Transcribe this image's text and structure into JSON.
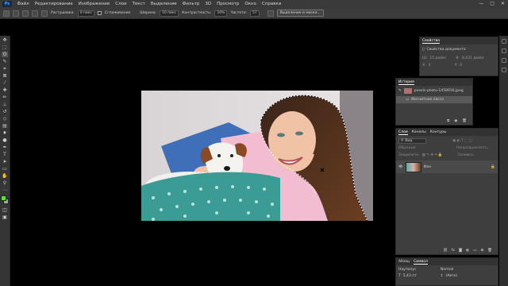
{
  "menubar": {
    "logo": "Ps",
    "items": [
      "Файл",
      "Редактирование",
      "Изображение",
      "Слои",
      "Текст",
      "Выделение",
      "Фильтр",
      "3D",
      "Просмотр",
      "Окно",
      "Справка"
    ],
    "window_controls": [
      "—",
      "▢",
      "✕"
    ]
  },
  "options": {
    "feather_label": "Растушевка:",
    "feather_value": "0 пикс",
    "antialias_label": "Сглаживание",
    "width_label": "Ширина:",
    "width_value": "10 пикс",
    "contrast_label": "Контрастность:",
    "contrast_value": "10%",
    "frequency_label": "Частота:",
    "frequency_value": "57",
    "select_mask_button": "Выделение и маска..."
  },
  "properties": {
    "tab": "Свойства",
    "doc_label": "Свойства документа",
    "w_label": "Ш:",
    "w_value": "15 дюйм",
    "h_label": "В:",
    "h_value": "8,431 дюйм",
    "x_label": "X:",
    "x_value": "0",
    "y_label": "Y:",
    "y_value": "0"
  },
  "history": {
    "tab": "История",
    "snapshot_name": "pexels-photo-1458916.jpeg",
    "step_label": "Магнитное лассо"
  },
  "layers": {
    "tabs": [
      "Слои",
      "Каналы",
      "Контуры"
    ],
    "kind_placeholder": "Вид",
    "blend_mode": "Обычные",
    "opacity_label": "Непрозрачность:",
    "lock_label": "Закрепить:",
    "fill_label": "Заливка:",
    "layer_name": "Фон"
  },
  "character": {
    "tabs": [
      "Абзац",
      "Символ"
    ],
    "font_family": "Наутилус",
    "font_style": "Normal",
    "size_value": "5,43 пт",
    "leading_value": "(Авто)"
  },
  "colors": {
    "menubar_bg": "#3a3a3a",
    "panel_bg": "#3e3e3e",
    "accent": "#31a8ff",
    "foreground_swatch": "#5ce32e",
    "background_swatch": "#a6a6a6"
  },
  "tools": [
    "move-tool-icon",
    "marquee-tool-icon",
    "lasso-tool-icon",
    "quick-select-tool-icon",
    "crop-tool-icon",
    "frame-tool-icon",
    "eyedropper-tool-icon",
    "healing-tool-icon",
    "brush-tool-icon",
    "stamp-tool-icon",
    "history-brush-tool-icon",
    "eraser-tool-icon",
    "gradient-tool-icon",
    "blur-tool-icon",
    "dodge-tool-icon",
    "pen-tool-icon",
    "type-tool-icon",
    "path-select-tool-icon",
    "rectangle-tool-icon",
    "hand-tool-icon",
    "zoom-tool-icon"
  ]
}
